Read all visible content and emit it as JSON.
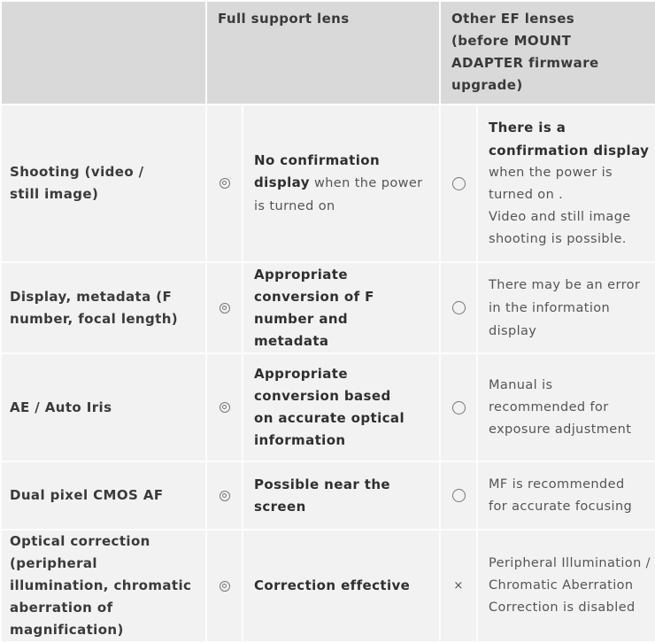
{
  "header": {
    "col_feature": "",
    "col_full_support": "Full support lens",
    "col_other_ef": "Other EF lenses (before MOUNT ADAPTER firmware upgrade)"
  },
  "symbols": {
    "double_circle": "◎",
    "circle": "○",
    "cross": "×"
  },
  "rows": [
    {
      "feature": "Shooting (video / still image)",
      "full_symbol": "double_circle",
      "full_bold": "No confirmation display",
      "full_normal": " when the power is turned on",
      "other_symbol": "circle",
      "other_bold": "There is a confirmation display",
      "other_normal": "when the power is turned on .",
      "other_normal2": "Video and still image shooting is possible."
    },
    {
      "feature": "Display, metadata (F number, focal length)",
      "full_symbol": "double_circle",
      "full_bold": "Appropriate conversion of F number and metadata",
      "other_symbol": "circle",
      "other_normal": "There may be an error in the information display"
    },
    {
      "feature": "AE / Auto Iris",
      "full_symbol": "double_circle",
      "full_bold": "Appropriate conversion based on accurate optical information",
      "other_symbol": "circle",
      "other_normal": "Manual is recommended for exposure adjustment"
    },
    {
      "feature": "Dual pixel CMOS AF",
      "full_symbol": "double_circle",
      "full_bold": "Possible near the screen",
      "other_symbol": "circle",
      "other_normal": "MF is recommended for accurate focusing"
    },
    {
      "feature": "Optical correction (peripheral illumination, chromatic aberration of magnification)",
      "full_symbol": "double_circle",
      "full_bold": "Correction effective",
      "other_symbol": "cross",
      "other_normal": "Peripheral Illumination / Chromatic Aberration Correction is disabled"
    }
  ]
}
